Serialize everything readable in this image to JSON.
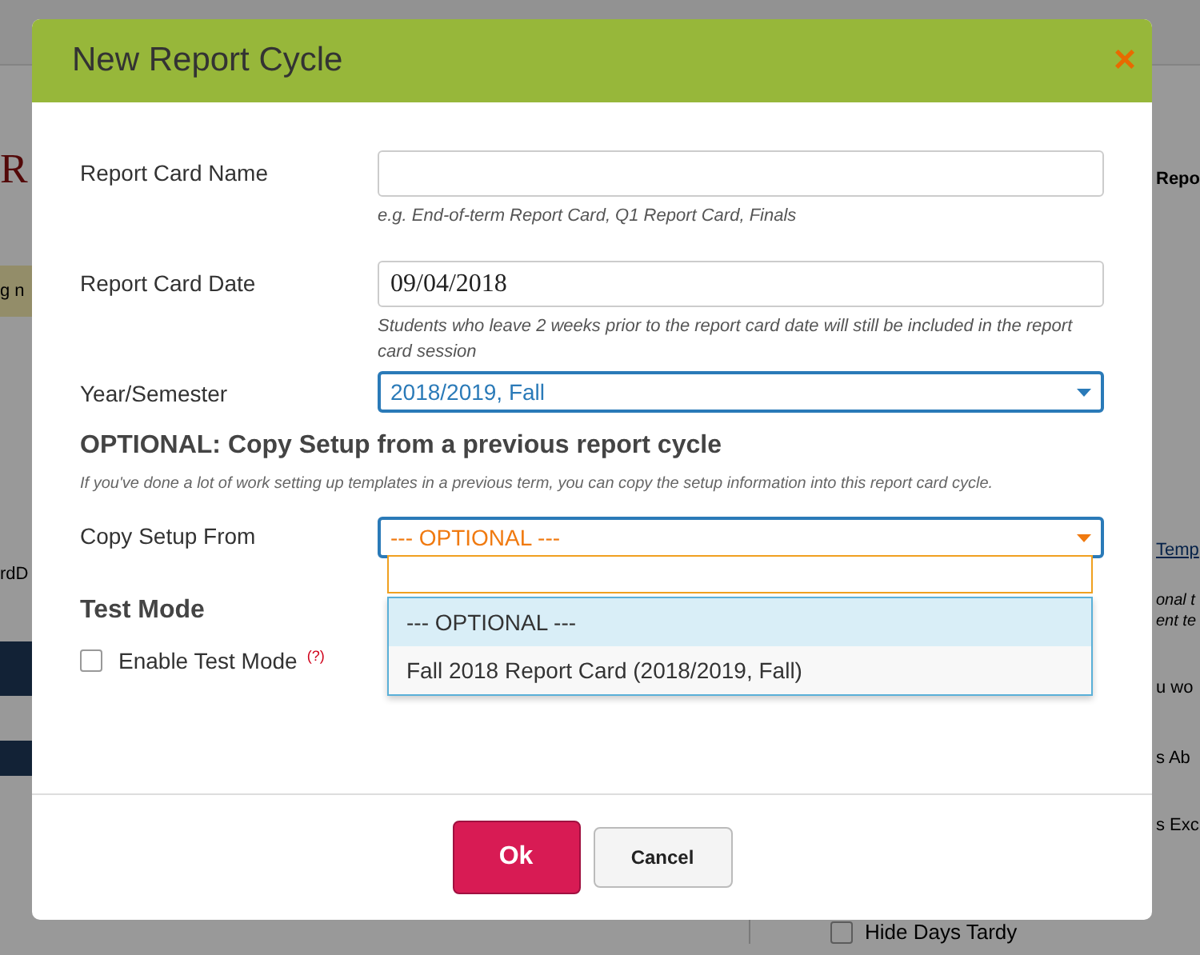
{
  "background": {
    "left": [
      {
        "text": "R",
        "kind": "logo"
      },
      {
        "text": "g n",
        "kind": "banner"
      },
      {
        "text": "rdD",
        "kind": "text"
      }
    ],
    "right": [
      {
        "text": "Repo",
        "kind": "tab"
      },
      {
        "text": "Temp",
        "kind": "link"
      },
      {
        "text": "onal t",
        "kind": "italic"
      },
      {
        "text": "ent te",
        "kind": "italic"
      },
      {
        "text": "u wo",
        "kind": "text"
      },
      {
        "text": "s Ab",
        "kind": "text"
      },
      {
        "text": "s Exc",
        "kind": "text"
      }
    ],
    "checkbox": {
      "label": "Hide Days Tardy",
      "checked": false
    }
  },
  "dialog": {
    "title": "New Report Cycle",
    "close": "×",
    "fields": [
      {
        "label": "Report Card Name",
        "kind": "text",
        "help": "e.g. End-of-term Report Card, Q1 Report Card, Finals"
      },
      {
        "label": "Report Card Date",
        "kind": "date",
        "value": "09/04/2018",
        "help": "Students who leave 2 weeks prior to the report card date will still be included in the report card session"
      },
      {
        "label": "Year/Semester",
        "kind": "select",
        "value": "2018/2019, Fall"
      }
    ],
    "copy_section": {
      "heading": "OPTIONAL: Copy Setup from a previous report cycle",
      "note": "If you've done a lot of work setting up templates in a previous term, you can copy the setup information into this report card cycle.",
      "field": {
        "label": "Copy Setup From",
        "value": "--- OPTIONAL ---",
        "expanded": true,
        "options": [
          {
            "label": "--- OPTIONAL ---",
            "selected": true
          },
          {
            "label": "Fall 2018 Report Card (2018/2019, Fall)",
            "selected": false
          }
        ]
      }
    },
    "test_mode": {
      "heading": "Test Mode",
      "checkbox": {
        "label": "Enable Test Mode",
        "checked": false
      },
      "help_mark": "(?)"
    },
    "buttons": [
      {
        "label": "Ok",
        "kind": "primary"
      },
      {
        "label": "Cancel",
        "kind": "secondary"
      }
    ]
  }
}
